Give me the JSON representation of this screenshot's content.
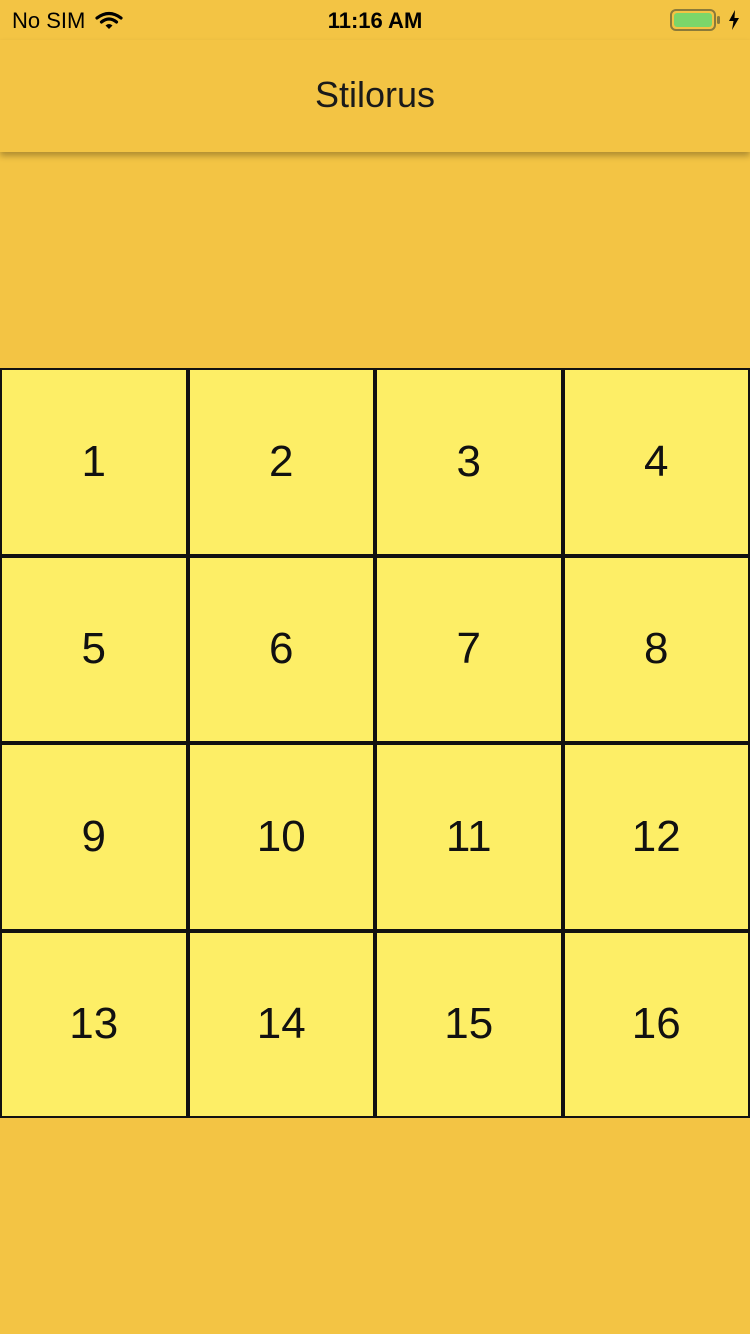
{
  "status_bar": {
    "carrier": "No SIM",
    "time": "11:16 AM",
    "wifi_icon": "wifi-icon",
    "battery_icon": "battery-icon",
    "charging_icon": "bolt-icon"
  },
  "nav": {
    "title": "Stilorus"
  },
  "colors": {
    "background": "#f3c444",
    "tile": "#fdee66",
    "tile_border": "#111111",
    "battery_fill": "#7bd66a"
  },
  "board": {
    "tiles": [
      "1",
      "2",
      "3",
      "4",
      "5",
      "6",
      "7",
      "8",
      "9",
      "10",
      "11",
      "12",
      "13",
      "14",
      "15",
      "16"
    ]
  }
}
